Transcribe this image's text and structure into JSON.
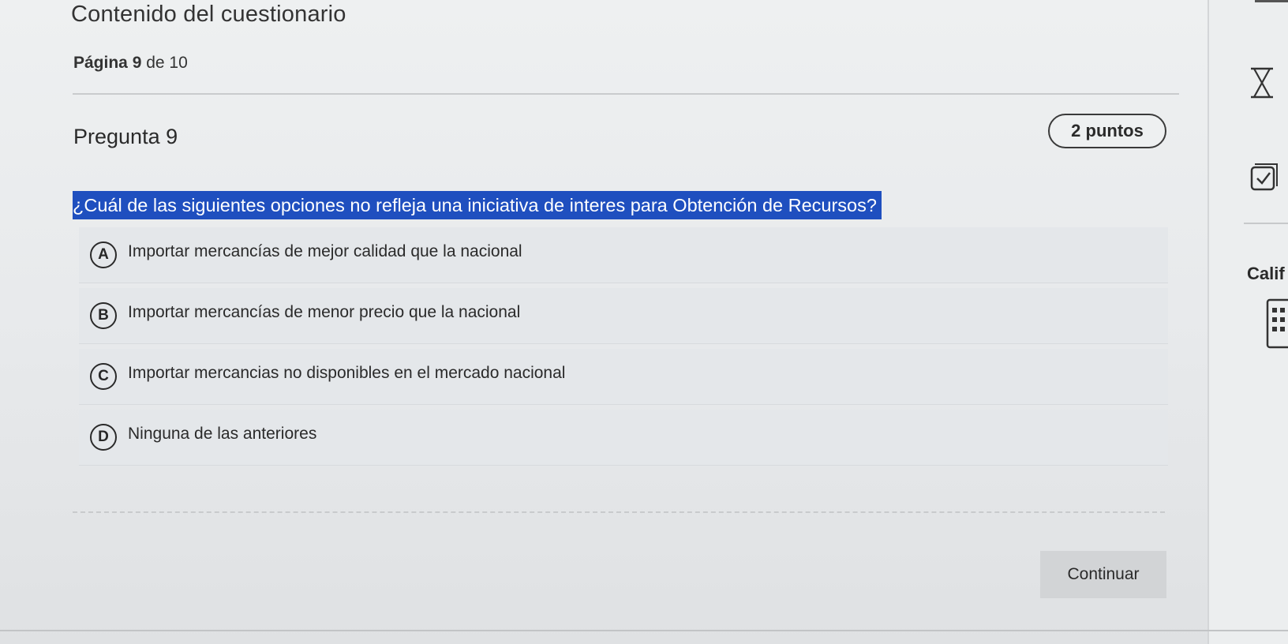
{
  "header": {
    "title": "Contenido del cuestionario",
    "page_label": "Página",
    "page_current": "9",
    "page_of": "de 10"
  },
  "question": {
    "title": "Pregunta 9",
    "points": "2 puntos",
    "text": "¿Cuál de las siguientes opciones no refleja una iniciativa de interes para Obtención de Recursos?",
    "options": [
      {
        "letter": "A",
        "text": "Importar mercancías de mejor calidad que la nacional"
      },
      {
        "letter": "B",
        "text": "Importar mercancías de menor precio que la nacional"
      },
      {
        "letter": "C",
        "text": "Importar mercancias no disponibles en el mercado nacional"
      },
      {
        "letter": "D",
        "text": "Ninguna de las anteriores"
      }
    ]
  },
  "actions": {
    "continue_label": "Continuar"
  },
  "sidebar": {
    "label": "Calif",
    "icons": [
      "hourglass-icon",
      "checkbox-icon",
      "calculator-icon"
    ]
  },
  "colors": {
    "selection_highlight": "#1f4fbf",
    "background": "#e9ebed"
  }
}
